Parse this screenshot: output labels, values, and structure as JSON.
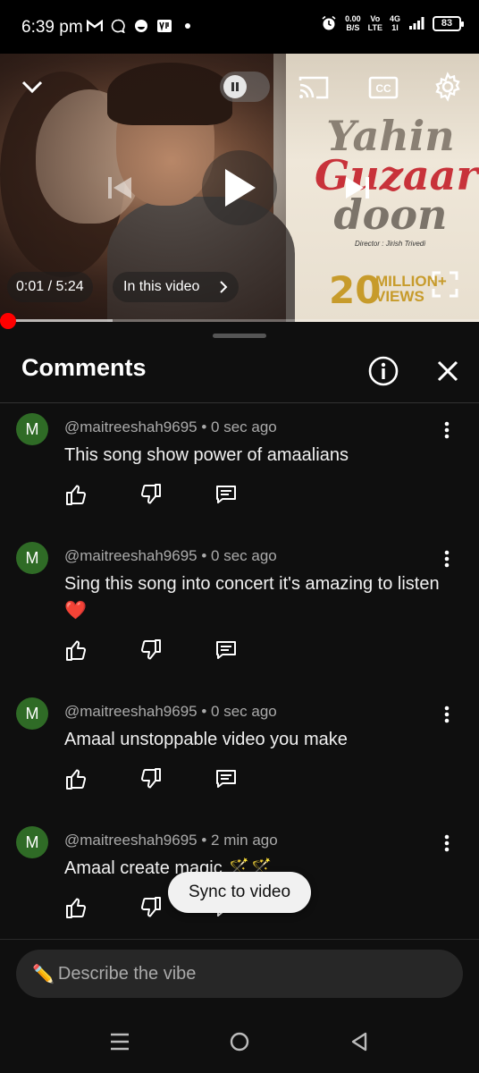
{
  "status_bar": {
    "time": "6:39 pm",
    "net_speed_value": "0.00",
    "net_speed_unit": "B/S",
    "volte_top": "Vo",
    "volte_bottom": "LTE",
    "network_top": "4G",
    "network_bottom": "1l",
    "battery": "83"
  },
  "video": {
    "title_art": [
      "Yahin",
      "Guzaar",
      "doon"
    ],
    "director_credit": "Director : Jirish Trivedi",
    "views_number": "20",
    "views_line1": "MILLION+",
    "views_line2": "VIEWS",
    "time_display": "0:01 / 5:24",
    "chapter_label": "In this video",
    "progress_fraction": 0.003,
    "buffer_fraction": 0.235
  },
  "panel": {
    "title": "Comments"
  },
  "comments": [
    {
      "avatar": "M",
      "author": "@maitreeshah9695",
      "age": "0 sec ago",
      "text": "This song show power of amaalians"
    },
    {
      "avatar": "M",
      "author": "@maitreeshah9695",
      "age": "0 sec ago",
      "text": "Sing this song into concert it's amazing to listen ❤️"
    },
    {
      "avatar": "M",
      "author": "@maitreeshah9695",
      "age": "0 sec ago",
      "text": "Amaal  unstoppable video you make"
    },
    {
      "avatar": "M",
      "author": "@maitreeshah9695",
      "age": "2 min ago",
      "text": "Amaal create magic 🪄🪄"
    }
  ],
  "sync_button": "Sync to video",
  "composer": {
    "icon": "✏️",
    "placeholder": "Describe the vibe"
  },
  "colors": {
    "background": "#0f0f0f",
    "progress": "#ff0000",
    "avatar": "#2f6b26"
  }
}
